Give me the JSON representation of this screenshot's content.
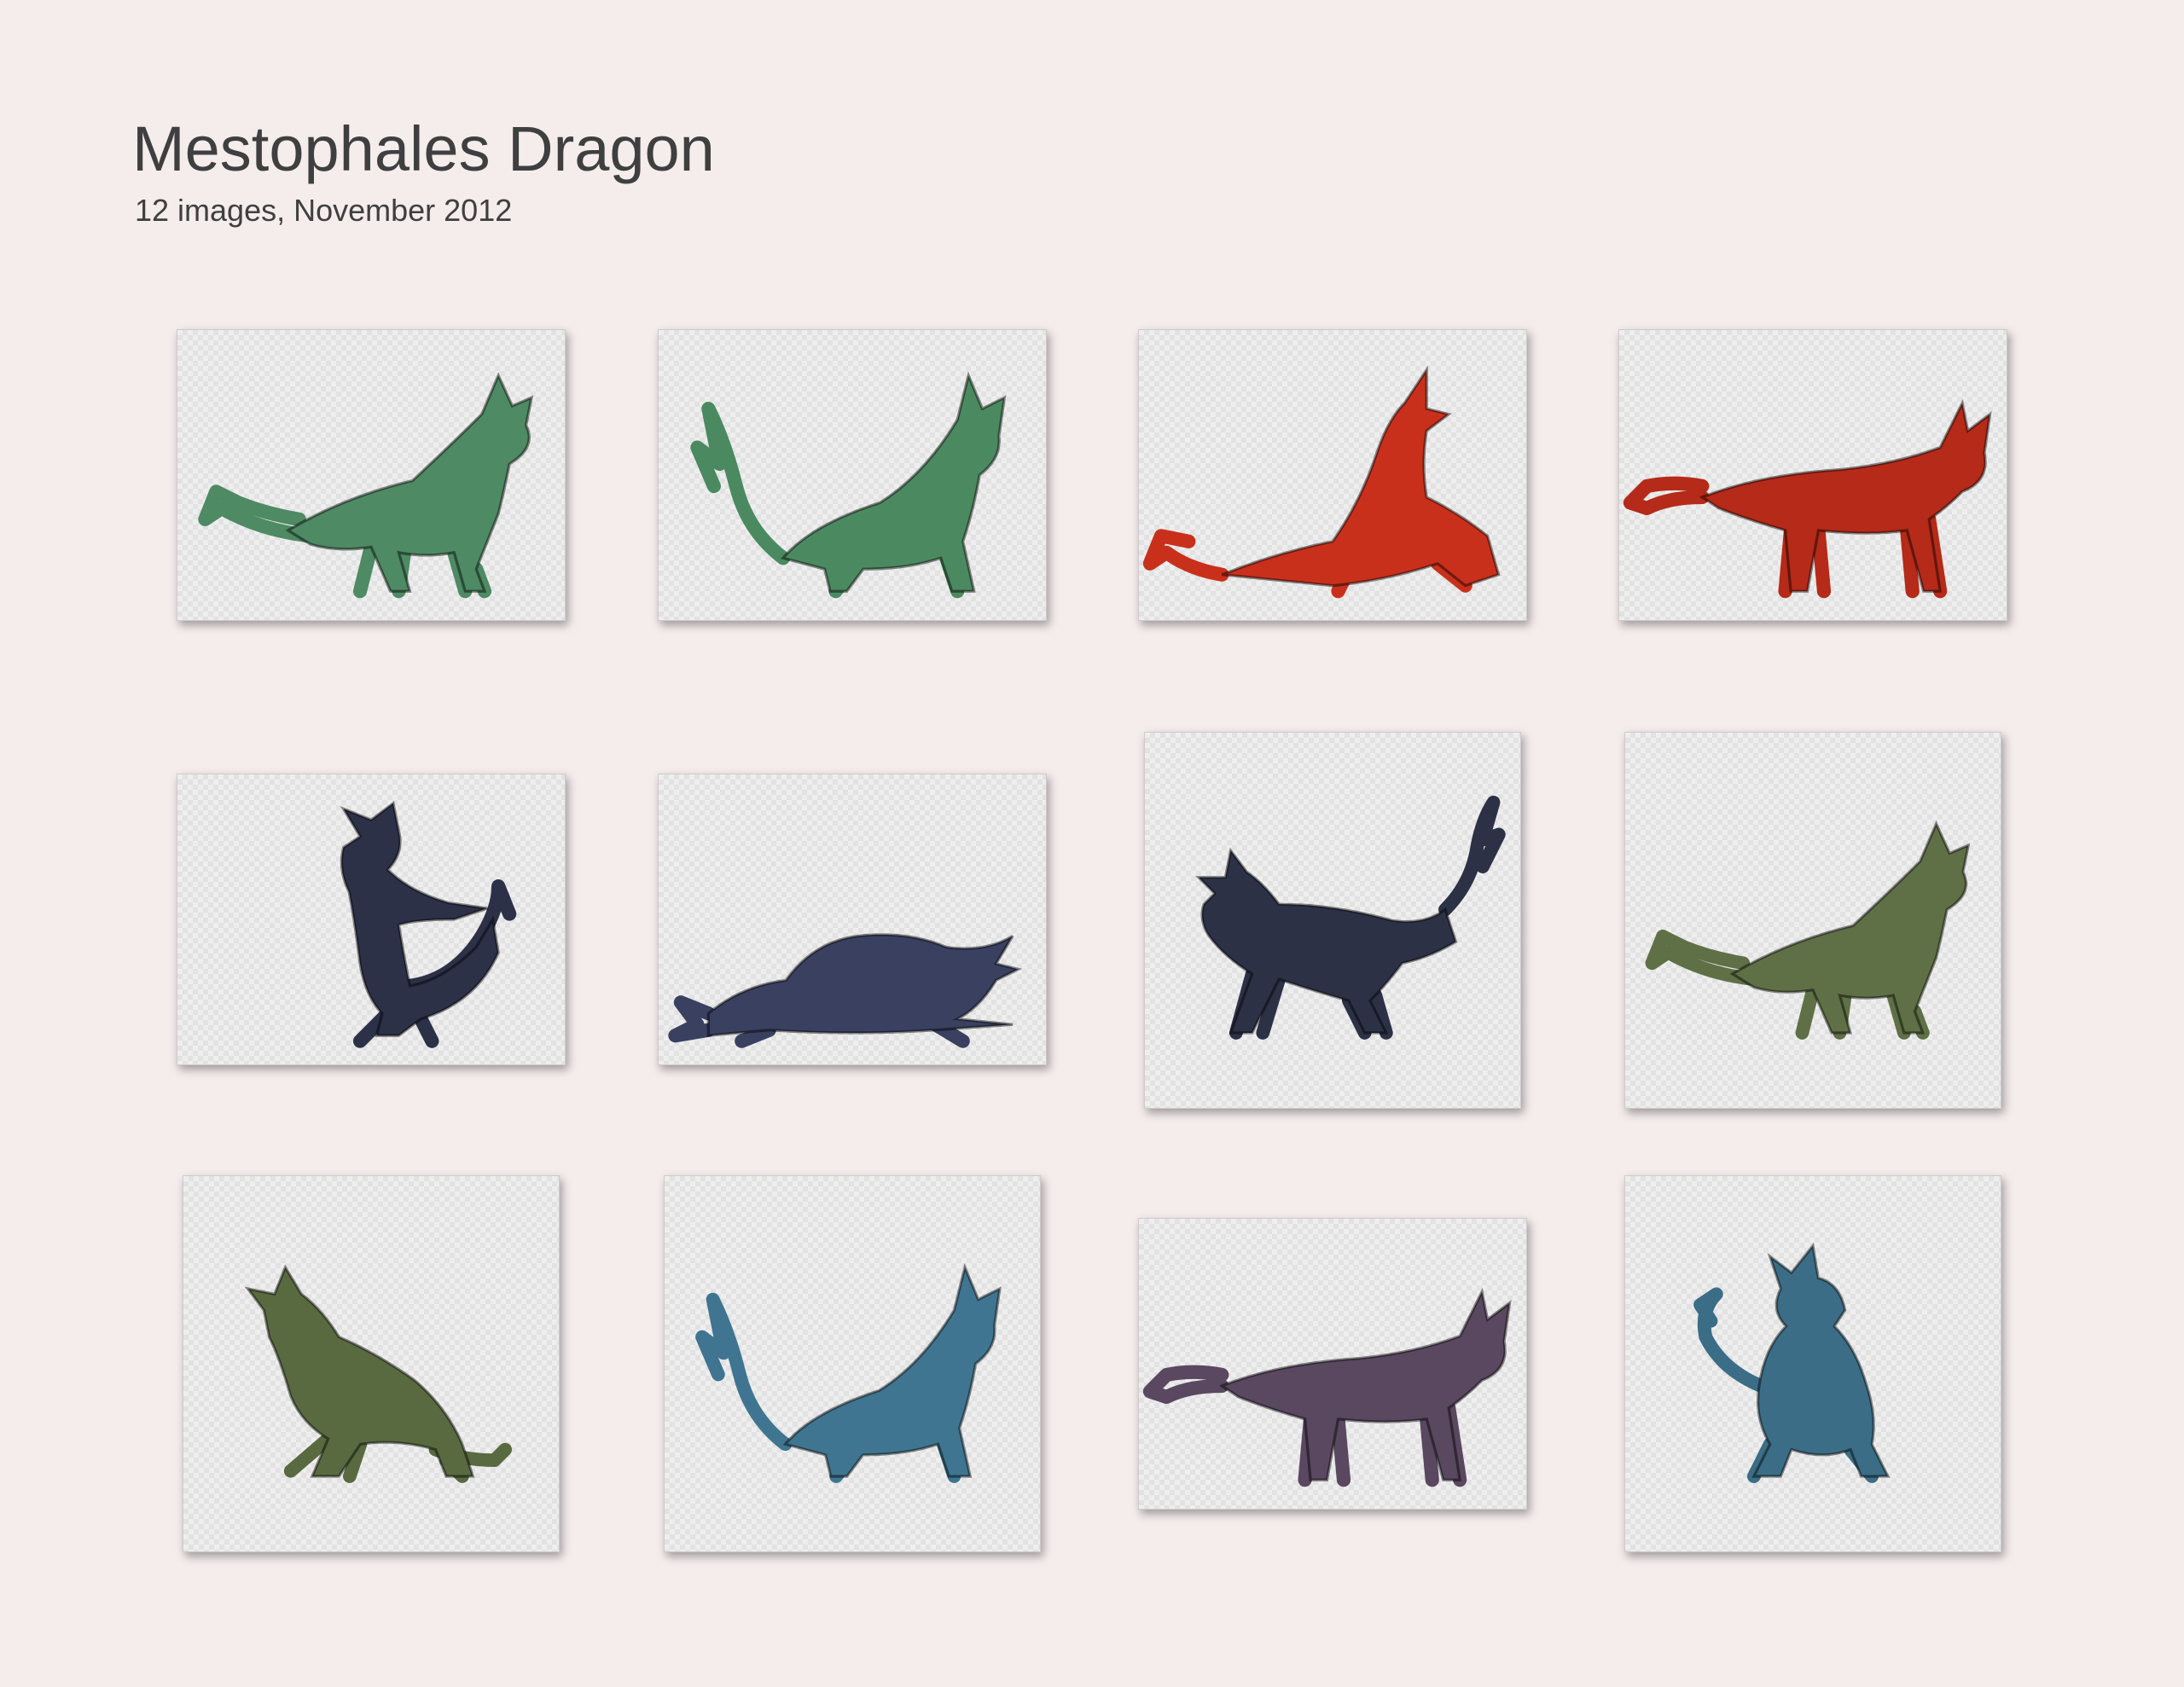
{
  "album": {
    "title": "Mestophales Dragon",
    "subtitle": "12 images, November 2012"
  },
  "images": [
    {
      "color": "#4e8a63",
      "pose": "standing-right"
    },
    {
      "color": "#4b8a60",
      "pose": "crouch-right"
    },
    {
      "color": "#c9301c",
      "pose": "lying-left"
    },
    {
      "color": "#b52a18",
      "pose": "walking-right"
    },
    {
      "color": "#2c3148",
      "pose": "rearing"
    },
    {
      "color": "#3a4060",
      "pose": "lying-back"
    },
    {
      "color": "#2c3146",
      "pose": "running-left"
    },
    {
      "color": "#5f7046",
      "pose": "standing-right"
    },
    {
      "color": "#596a41",
      "pose": "crouch-left"
    },
    {
      "color": "#3f7590",
      "pose": "crouch-right"
    },
    {
      "color": "#5a4760",
      "pose": "walking-right"
    },
    {
      "color": "#3b6d86",
      "pose": "front-facing"
    }
  ]
}
